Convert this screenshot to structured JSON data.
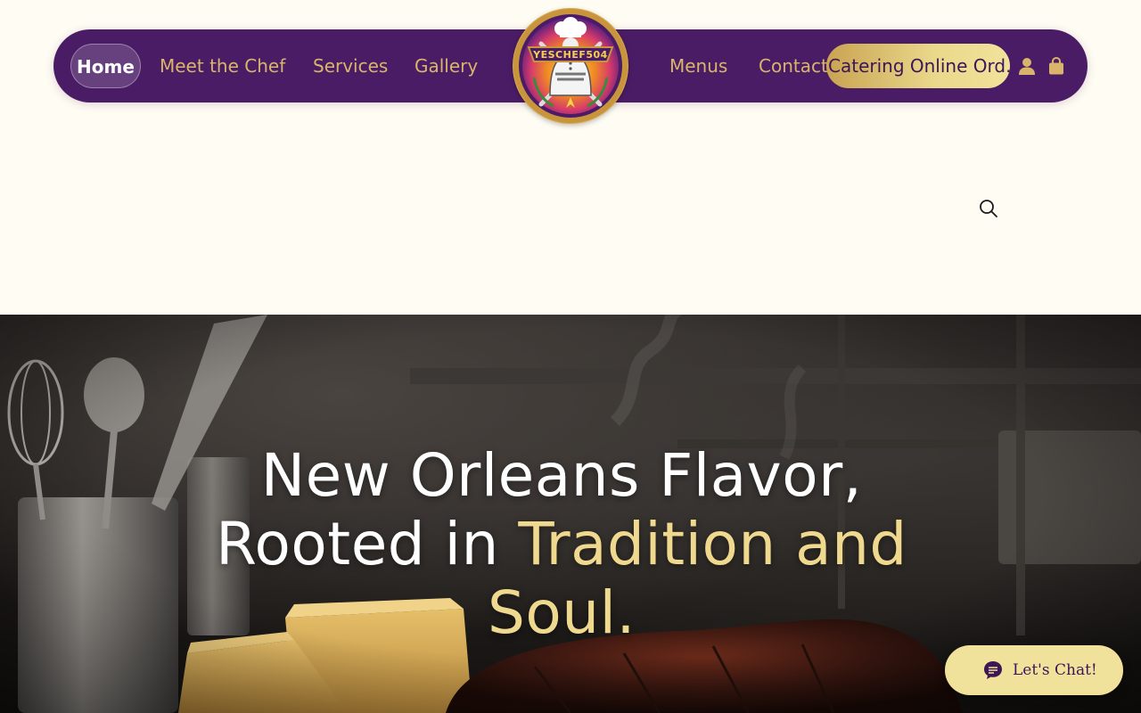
{
  "nav": {
    "home": "Home",
    "meet_chef": "Meet the Chef",
    "services": "Services",
    "gallery": "Gallery",
    "menus": "Menus",
    "contact": "Contact",
    "catering": "Catering Online Ord…",
    "account_icon": "user-icon",
    "cart_icon": "shopping-bag-icon"
  },
  "logo": {
    "text": "YESCHEF504",
    "alt": "Yes Chef 504 logo"
  },
  "search": {
    "icon": "search-icon"
  },
  "hero": {
    "line1": "New Orleans Flavor,",
    "line2_white": "Rooted in ",
    "line2_gold": "Tradition and",
    "line3_gold": "Soul."
  },
  "chat": {
    "label": "Let's Chat!",
    "icon": "chat-bubble-icon"
  },
  "colors": {
    "background": "#fffcf3",
    "nav_purple": "#4a1c66",
    "nav_gold": "#d9b56b",
    "cta_gold": "#efd98e",
    "chat_bg": "#f1e29b"
  }
}
